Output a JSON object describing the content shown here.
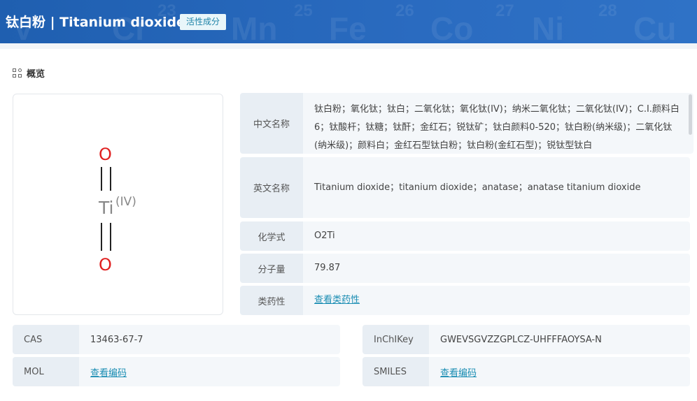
{
  "header": {
    "title": "钛白粉 | Titanium dioxide",
    "badge": "活性成分",
    "background_elements": [
      {
        "symbol": "V",
        "number": ""
      },
      {
        "symbol": "Cr",
        "number": "23"
      },
      {
        "symbol": "Mn",
        "number": "25"
      },
      {
        "symbol": "Fe",
        "number": "26"
      },
      {
        "symbol": "Co",
        "number": "27"
      },
      {
        "symbol": "Ni",
        "number": "28"
      },
      {
        "symbol": "Cu",
        "number": ""
      }
    ]
  },
  "overview": {
    "title": "概览"
  },
  "structure": {
    "top_atom": "O",
    "center_atom": "Ti",
    "center_charge": "(IV)",
    "bottom_atom": "O"
  },
  "properties": [
    {
      "label": "中文名称",
      "value": "钛白粉；氧化钛；钛白；二氧化钛；氧化钛(IV)；纳米二氧化钛；二氧化钛(IV)；C.I.颜料白6；钛酸杆；钛糖；钛酐；金红石；锐钛矿；钛白颜料0-520；钛白粉(纳米级)；二氧化钛(纳米级)；颜料白；金红石型钛白粉；钛白粉(金红石型)；锐钛型钛白",
      "is_link": false
    },
    {
      "label": "英文名称",
      "value": "Titanium dioxide；titanium dioxide；anatase；anatase titanium dioxide",
      "is_link": false
    },
    {
      "label": "化学式",
      "value": "O2Ti",
      "is_link": false
    },
    {
      "label": "分子量",
      "value": "79.87",
      "is_link": false
    },
    {
      "label": "类药性",
      "value": "查看类药性",
      "is_link": true
    }
  ],
  "identifiers": [
    {
      "label": "CAS",
      "value": "13463-67-7",
      "is_link": false
    },
    {
      "label": "InChIKey",
      "value": "GWEVSGVZZGPLCZ-UHFFFAOYSA-N",
      "is_link": false
    },
    {
      "label": "MOL",
      "value": "查看编码",
      "is_link": true
    },
    {
      "label": "SMILES",
      "value": "查看编码",
      "is_link": true
    }
  ],
  "colors": {
    "header": "#2a6bc0",
    "badge_text": "#1f84a8",
    "link": "#1a8db3",
    "oxygen": "#e02020",
    "titanium": "#888888"
  }
}
